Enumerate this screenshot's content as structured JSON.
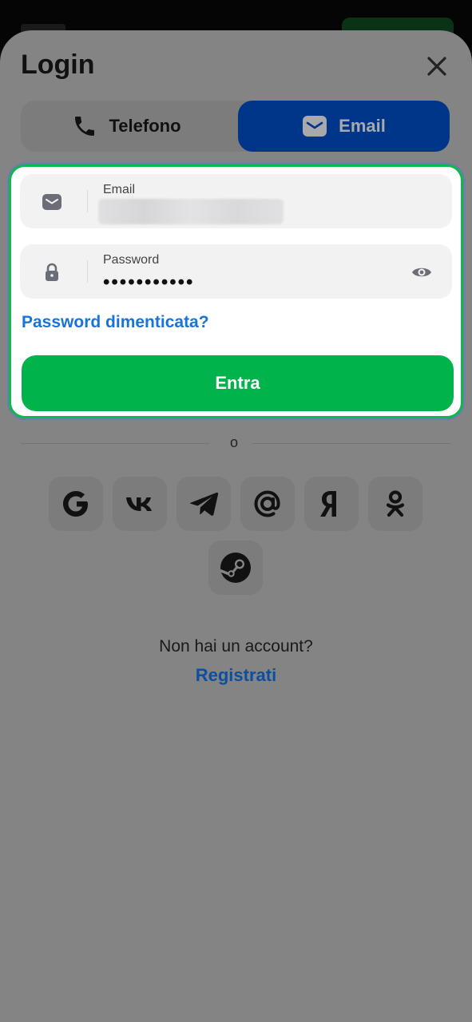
{
  "modal": {
    "title": "Login"
  },
  "tabs": {
    "phone_label": "Telefono",
    "email_label": "Email",
    "active": "email"
  },
  "form": {
    "email_label": "Email",
    "password_label": "Password",
    "password_value": "•••••••••••",
    "forgot_label": "Password dimenticata?",
    "submit_label": "Entra"
  },
  "divider_text": "o",
  "social_providers": [
    "google-icon",
    "vk-icon",
    "telegram-icon",
    "mail-at-icon",
    "yandex-icon",
    "odnoklassniki-icon",
    "steam-icon"
  ],
  "signup": {
    "prompt": "Non hai un account?",
    "link": "Registrati"
  },
  "colors": {
    "primary_green": "#00b34a",
    "active_tab": "#00368a",
    "link_blue": "#1a73d9",
    "overlay_gray": "#848484"
  }
}
